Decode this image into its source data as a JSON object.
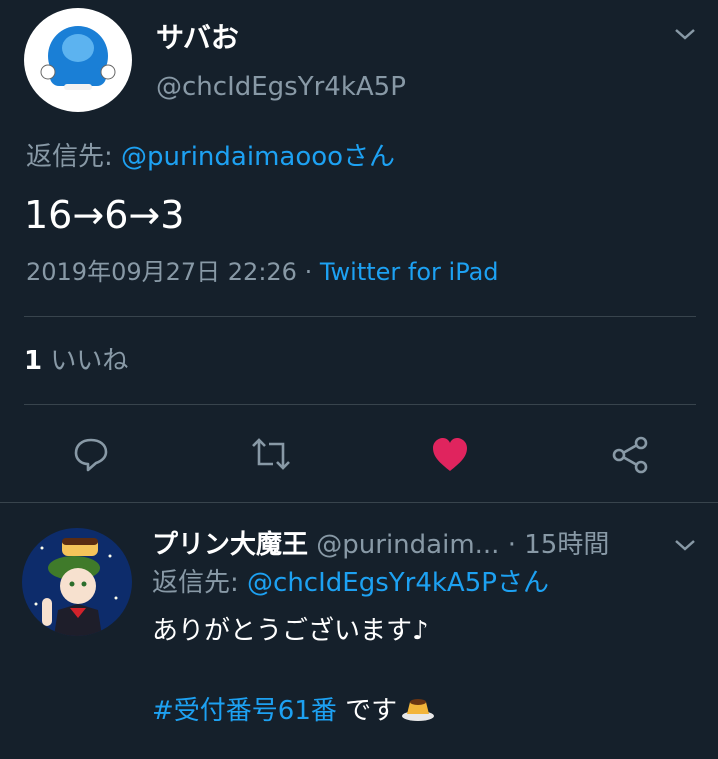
{
  "tweet": {
    "display_name": "サバお",
    "handle": "@chcIdEgsYr4kA5P",
    "reply_label": "返信先: ",
    "reply_to": "@purindaimaooo",
    "reply_suffix": "さん",
    "text": "16→6→3",
    "timestamp": "2019年09月27日 22:26",
    "dot": " · ",
    "source": "Twitter for iPad",
    "like_count": "1",
    "like_label": " いいね",
    "liked": true
  },
  "reply": {
    "display_name": "プリン大魔王",
    "handle": "@purindaim...",
    "time": " · 15時間",
    "reply_label": "返信先: ",
    "reply_to": "@chcIdEgsYr4kA5P",
    "reply_suffix": "さん",
    "line1": "ありがとうございます♪",
    "hashtag": "#受付番号61番",
    "line2_suffix": " です"
  },
  "actions": {
    "icons": [
      "reply-icon",
      "retweet-icon",
      "like-icon",
      "share-icon"
    ]
  },
  "colors": {
    "background": "#15202b",
    "accent": "#1da1f2",
    "like": "#e0245e",
    "muted": "#8899a6",
    "divider": "#38444d"
  }
}
